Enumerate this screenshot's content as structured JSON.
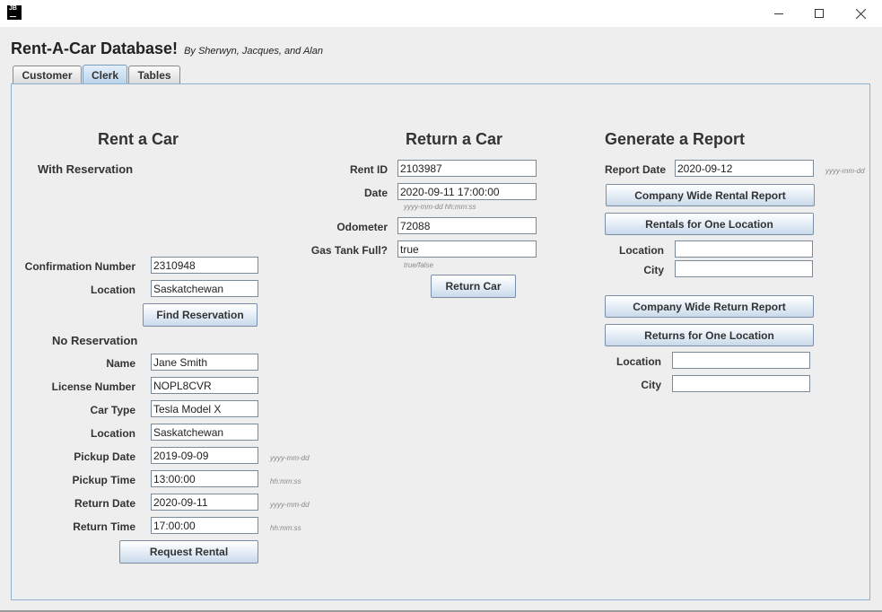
{
  "window": {
    "icon_label": "JB",
    "controls": {
      "minimize": "minimize-icon",
      "maximize": "maximize-icon",
      "close": "close-icon"
    }
  },
  "app": {
    "title": "Rent-A-Car Database!",
    "subtitle": "By Sherwyn, Jacques, and Alan"
  },
  "tabs": [
    {
      "label": "Customer",
      "active": false
    },
    {
      "label": "Clerk",
      "active": true
    },
    {
      "label": "Tables",
      "active": false
    }
  ],
  "rent": {
    "heading": "Rent a Car",
    "with_reservation": {
      "heading": "With Reservation",
      "confirmation_label": "Confirmation Number",
      "confirmation_value": "2310948",
      "location_label": "Location",
      "location_value": "Saskatchewan",
      "find_button": "Find Reservation"
    },
    "no_reservation": {
      "heading": "No Reservation",
      "name_label": "Name",
      "name_value": "Jane Smith",
      "license_label": "License Number",
      "license_value": "NOPL8CVR",
      "cartype_label": "Car Type",
      "cartype_value": "Tesla Model X",
      "location_label": "Location",
      "location_value": "Saskatchewan",
      "pickup_date_label": "Pickup Date",
      "pickup_date_value": "2019-09-09",
      "pickup_date_hint": "yyyy-mm-dd",
      "pickup_time_label": "Pickup Time",
      "pickup_time_value": "13:00:00",
      "pickup_time_hint": "hh:mm:ss",
      "return_date_label": "Return Date",
      "return_date_value": "2020-09-11",
      "return_date_hint": "yyyy-mm-dd",
      "return_time_label": "Return Time",
      "return_time_value": "17:00:00",
      "return_time_hint": "hh:mm:ss",
      "request_button": "Request Rental"
    }
  },
  "return_car": {
    "heading": "Return a Car",
    "rentid_label": "Rent ID",
    "rentid_value": "2103987",
    "date_label": "Date",
    "date_value": "2020-09-11 17:00:00",
    "date_hint": "yyyy-mm-dd hh:mm:ss",
    "odometer_label": "Odometer",
    "odometer_value": "72088",
    "gastank_label": "Gas Tank Full?",
    "gastank_value": "true",
    "gastank_hint": "true/false",
    "return_button": "Return Car"
  },
  "report": {
    "heading": "Generate a Report",
    "date_label": "Report Date",
    "date_value": "2020-09-12",
    "date_hint": "yyyy-mm-dd",
    "company_rental_button": "Company Wide Rental Report",
    "rentals_location_button": "Rentals for One Location",
    "rental_location_label": "Location",
    "rental_location_value": "",
    "rental_city_label": "City",
    "rental_city_value": "",
    "company_return_button": "Company Wide Return Report",
    "returns_location_button": "Returns for One Location",
    "return_location_label": "Location",
    "return_location_value": "",
    "return_city_label": "City",
    "return_city_value": ""
  }
}
